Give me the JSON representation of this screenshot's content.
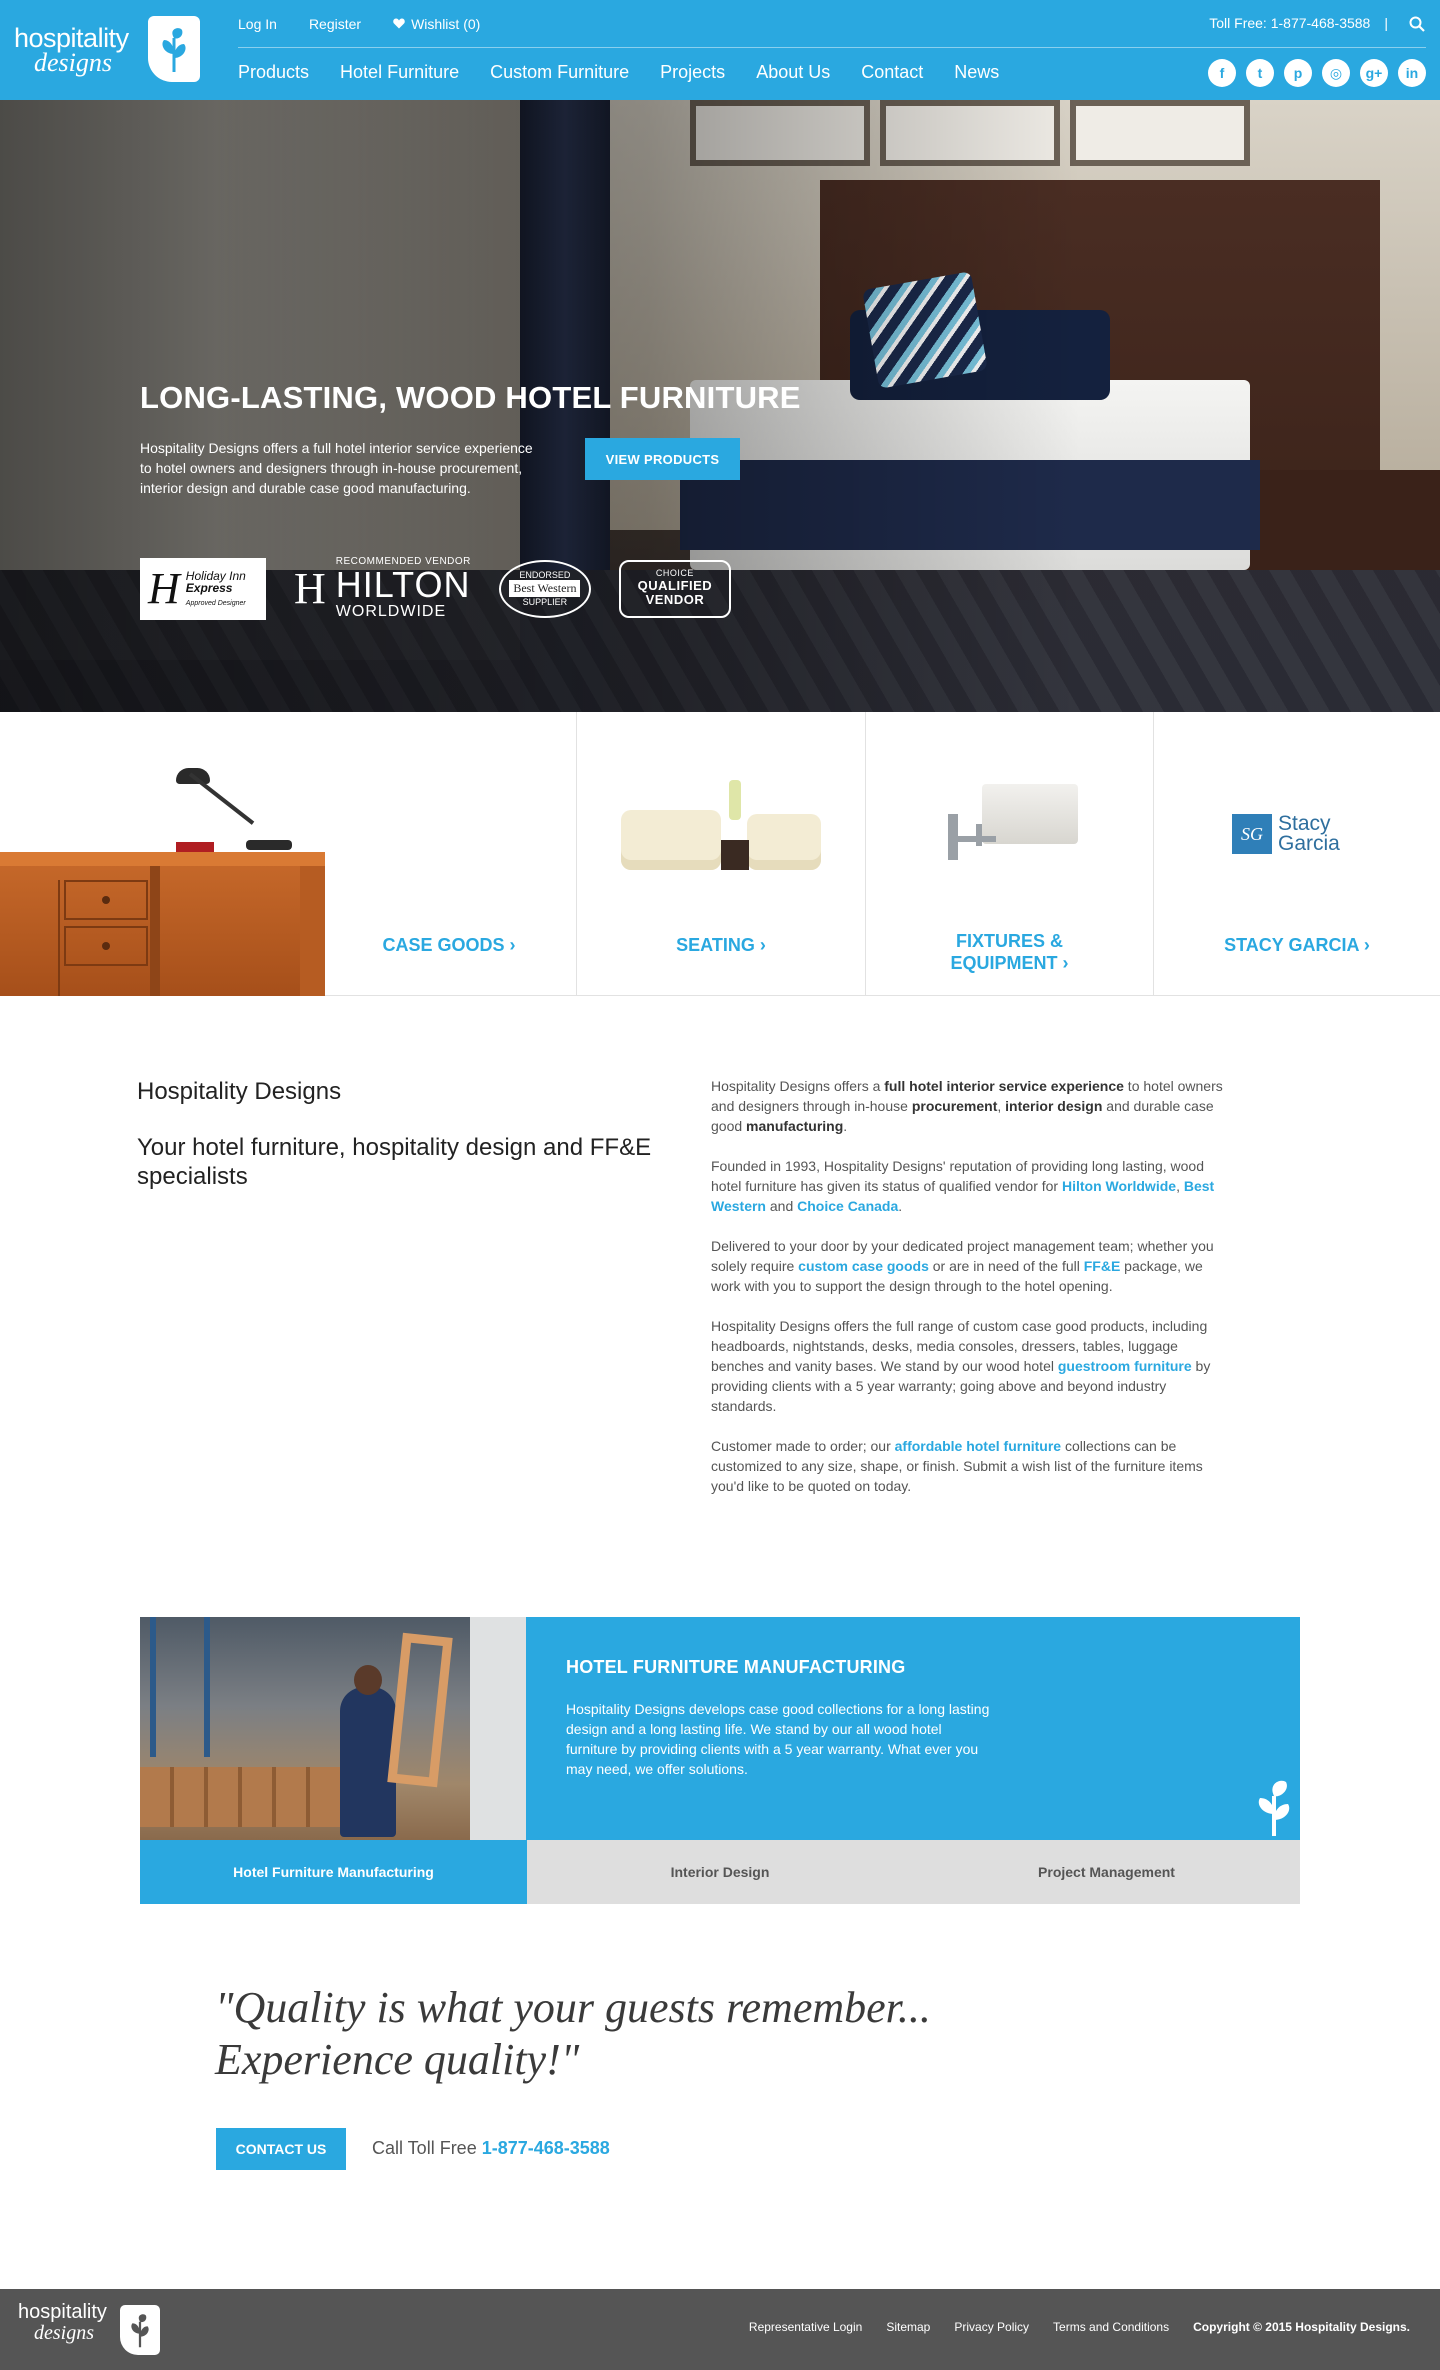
{
  "header": {
    "logo_line1": "hospitality",
    "logo_line2": "designs",
    "top_links": {
      "login": "Log In",
      "register": "Register",
      "wishlist": "Wishlist (0)"
    },
    "toll_free": "Toll Free: 1-877-468-3588",
    "separator": "|",
    "nav": [
      "Products",
      "Hotel Furniture",
      "Custom Furniture",
      "Projects",
      "About Us",
      "Contact",
      "News"
    ],
    "social": [
      "facebook-icon",
      "twitter-icon",
      "pinterest-icon",
      "instagram-icon",
      "google-plus-icon",
      "linkedin-icon"
    ],
    "social_glyphs": [
      "f",
      "t",
      "p",
      "◎",
      "g+",
      "in"
    ]
  },
  "hero": {
    "title": "LONG-LASTING, WOOD HOTEL FURNITURE",
    "description": "Hospitality Designs offers a full hotel interior service experience to hotel owners and designers through in-house procurement, interior design and durable case good manufacturing.",
    "button": "VIEW PRODUCTS",
    "badges": {
      "hie_mark": "H",
      "hie_line1": "Holiday Inn",
      "hie_line2": "Express",
      "hie_line3": "Approved Designer",
      "hilton_mark": "H",
      "hilton_recommended": "RECOMMENDED VENDOR",
      "hilton_name": "HILTON",
      "hilton_worldwide": "WORLDWIDE",
      "bw_top": "ENDORSED",
      "bw_mid": "Best Western",
      "bw_bottom": "SUPPLIER",
      "choice_top": "CHOICE",
      "choice_line1": "QUALIFIED",
      "choice_line2": "VENDOR"
    }
  },
  "categories": [
    {
      "label": "CASE GOODS"
    },
    {
      "label": "SEATING"
    },
    {
      "label_line1": "FIXTURES &",
      "label_line2": "EQUIPMENT"
    },
    {
      "label": "STACY GARCIA",
      "logo_line1": "Stacy",
      "logo_line2": "Garcia",
      "logo_mark": "SG"
    }
  ],
  "intro": {
    "title": "Hospitality Designs",
    "subtitle": "Your hotel furniture, hospitality design and FF&E specialists",
    "p1": {
      "a": "Hospitality Designs offers a ",
      "b": "full hotel interior service experience",
      "c": " to hotel owners and designers through in-house ",
      "d": "procurement",
      "e": ", ",
      "f": "interior design",
      "g": " and durable case good ",
      "h": "manufacturing",
      "i": "."
    },
    "p2": {
      "a": "Founded in 1993, Hospitality Designs' reputation of providing long lasting, wood hotel furniture has given its status of qualified vendor for ",
      "link1": "Hilton Worldwide",
      "b": ", ",
      "link2": "Best Western",
      "c": " and ",
      "link3": "Choice Canada",
      "d": "."
    },
    "p3": {
      "a": "Delivered to your door by your dedicated project management team; whether you solely require ",
      "link1": "custom case goods",
      "b": " or are in need of the full ",
      "link2": "FF&E",
      "c": " package, we work with you to support the design through to the hotel opening."
    },
    "p4": {
      "a": "Hospitality Designs offers the full range of custom case good products, including headboards, nightstands, desks, media consoles, dressers, tables, luggage benches and vanity bases. We stand by our wood hotel ",
      "link1": "guestroom furniture",
      "b": " by providing clients with a 5 year warranty; going above and beyond industry standards."
    },
    "p5": {
      "a": "Customer made to order; our ",
      "link1": "affordable hotel furniture",
      "b": " collections can be customized to any size, shape, or finish. Submit a wish list of the furniture items you'd like to be quoted on today."
    }
  },
  "feature": {
    "title": "HOTEL FURNITURE MANUFACTURING",
    "text": "Hospitality Designs develops case good collections for a long lasting design and a long lasting life. We stand by our all wood hotel furniture by providing clients with a 5 year warranty. What ever you may need, we offer solutions.",
    "tabs": [
      "Hotel Furniture Manufacturing",
      "Interior Design",
      "Project Management"
    ],
    "active_tab": 0
  },
  "quote": {
    "line1": "\"Quality is what your guests remember...",
    "line2": "Experience quality!\"",
    "button": "CONTACT US",
    "call_label": "Call Toll Free ",
    "call_number": "1-877-468-3588"
  },
  "footer": {
    "logo_line1": "hospitality",
    "logo_line2": "designs",
    "links": [
      "Representative Login",
      "Sitemap",
      "Privacy Policy",
      "Terms and Conditions"
    ],
    "copyright": "Copyright © 2015 Hospitality Designs."
  },
  "colors": {
    "brand_blue": "#2aa8e0",
    "footer_gray": "#555555",
    "tab_gray": "#dedede"
  }
}
